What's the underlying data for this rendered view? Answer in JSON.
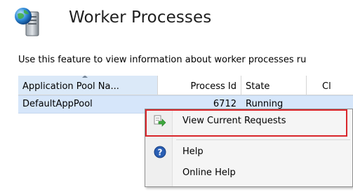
{
  "header": {
    "title": "Worker Processes",
    "icon": "server-globe-icon"
  },
  "description": "Use this feature to view information about worker processes ru",
  "table": {
    "columns": [
      "Application Pool Na...",
      "Process Id",
      "State",
      "Cl"
    ],
    "sorted_column": "Application Pool Na...",
    "rows": [
      {
        "app_pool": "DefaultAppPool",
        "process_id": "6712",
        "state": "Running"
      }
    ]
  },
  "context_menu": {
    "items": [
      {
        "label": "View Current Requests",
        "icon": "view-requests-icon",
        "highlighted": true
      },
      {
        "label": "Help",
        "icon": "help-icon"
      },
      {
        "label": "Online Help",
        "icon": ""
      }
    ]
  },
  "colors": {
    "selection": "#d6e6fa",
    "annotation_box": "#d9262b",
    "help_icon": "#2a5fb4"
  }
}
